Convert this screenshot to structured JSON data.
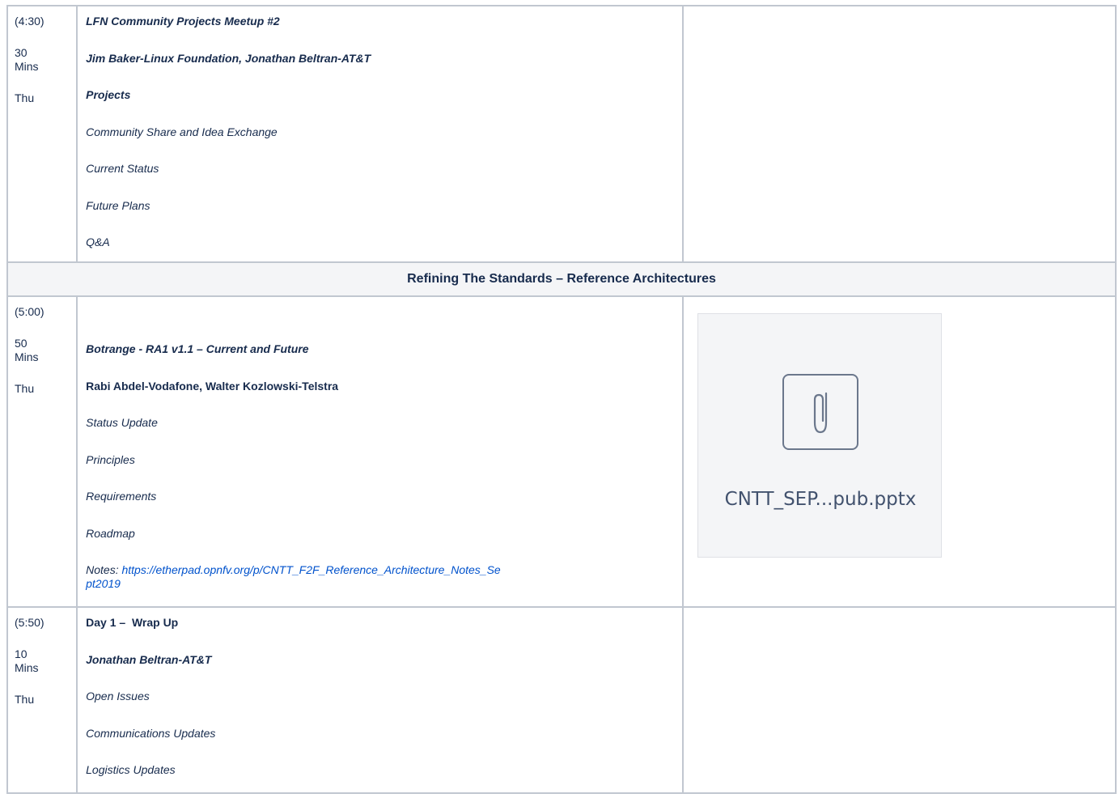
{
  "rows": [
    {
      "time": "(4:30)",
      "duration": "30 Mins",
      "day": "Thu",
      "title": "LFN Community Projects Meetup #2",
      "speakers": "Jim Baker-Linux Foundation, Jonathan Beltran-AT&T",
      "subheading": "Projects",
      "items": [
        "Community Share and Idea Exchange",
        "Current Status",
        "Future Plans",
        "Q&A"
      ]
    },
    {
      "time": "(5:00)",
      "duration": "50 Mins",
      "day": "Thu",
      "title": "Botrange - RA1 v1.1 – Current and Future",
      "speakers": "Rabi Abdel-Vodafone, Walter Kozlowski-Telstra",
      "items": [
        "Status Update",
        "Principles",
        "Requirements",
        "Roadmap"
      ],
      "notes_label": "Notes: ",
      "notes_link": "https://etherpad.opnfv.org/p/CNTT_F2F_Reference_Architecture_Notes_Sept2019",
      "attachment": {
        "name": "CNTT_SEP...pub.pptx",
        "icon": "paperclip-icon"
      }
    },
    {
      "time": "(5:50)",
      "duration": "10 Mins",
      "day": "Thu",
      "title": "Day 1 –  Wrap Up",
      "speakers": "Jonathan Beltran-AT&T",
      "items": [
        "Open Issues",
        "Communications Updates",
        "Logistics Updates"
      ]
    }
  ],
  "section_header": "Refining The Standards – Reference Architectures",
  "colors": {
    "border": "#c1c7d0",
    "header_bg": "#f4f5f7",
    "link": "#0052cc"
  }
}
